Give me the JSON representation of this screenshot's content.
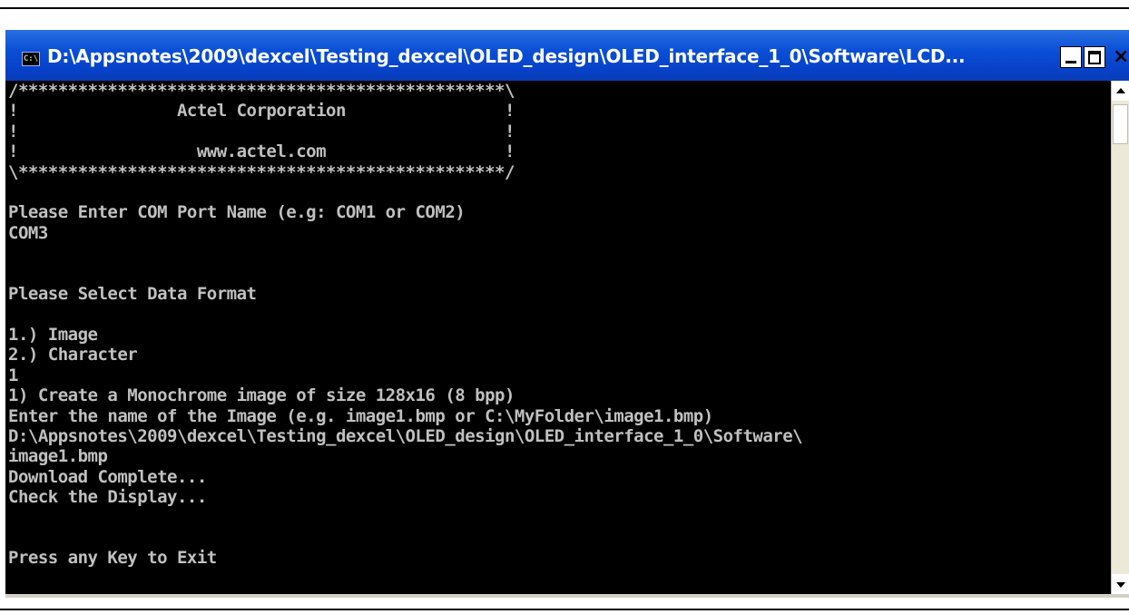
{
  "window": {
    "title": "D:\\Appsnotes\\2009\\dexcel\\Testing_dexcel\\OLED_design\\OLED_interface_1_0\\Software\\LCD...",
    "icon_text": "C:\\",
    "icon": "console-icon",
    "controls": {
      "minimize": "minimize-icon",
      "maximize": "maximize-icon",
      "close": "×"
    }
  },
  "console": {
    "lines": [
      "/*************************************************\\",
      "!                Actel Corporation                !",
      "!                                                 !",
      "!                  www.actel.com                  !",
      "\\*************************************************/",
      "",
      "Please Enter COM Port Name (e.g: COM1 or COM2)",
      "COM3",
      "",
      "",
      "Please Select Data Format",
      "",
      "1.) Image",
      "2.) Character",
      "1",
      "1) Create a Monochrome image of size 128x16 (8 bpp)",
      "Enter the name of the Image (e.g. image1.bmp or C:\\MyFolder\\image1.bmp)",
      "D:\\Appsnotes\\2009\\dexcel\\Testing_dexcel\\OLED_design\\OLED_interface_1_0\\Software\\",
      "image1.bmp",
      "Download Complete...",
      "Check the Display...",
      "",
      "",
      "Press any Key to Exit"
    ]
  },
  "colors": {
    "console_bg": "#000000",
    "console_text": "#c0c0c0",
    "titlebar": "#0a4fd6"
  }
}
